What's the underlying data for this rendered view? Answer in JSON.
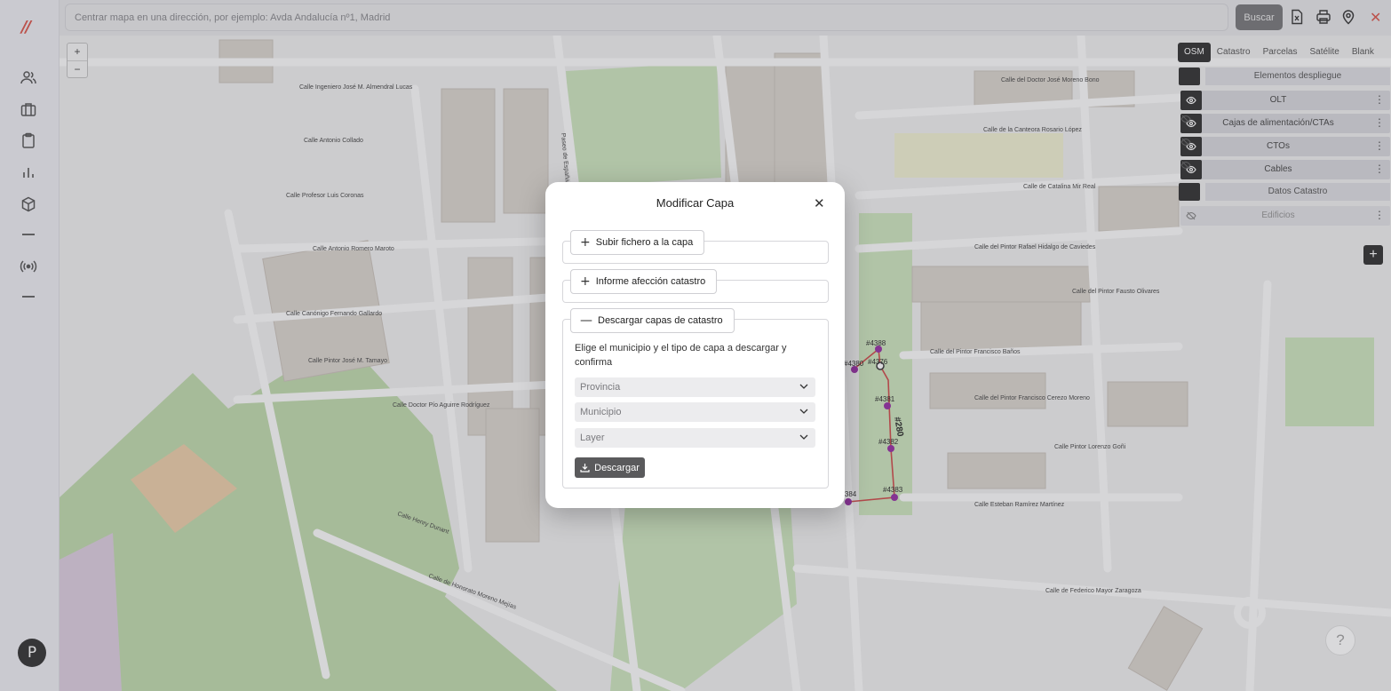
{
  "app": {
    "logo": "//"
  },
  "sidebar": {
    "items": [
      {
        "icon": "users-icon"
      },
      {
        "icon": "briefcase-icon"
      },
      {
        "icon": "clipboard-icon"
      },
      {
        "icon": "bar-chart-icon"
      },
      {
        "icon": "box-icon"
      },
      {
        "icon": "minus-icon"
      },
      {
        "icon": "broadcast-icon"
      },
      {
        "icon": "minus-icon"
      }
    ],
    "avatar_initial": "P"
  },
  "search": {
    "placeholder": "Centrar mapa en una dirección, por ejemplo: Avda Andalucía nº1, Madrid",
    "button_label": "Buscar"
  },
  "map": {
    "zoom_in": "+",
    "zoom_out": "−",
    "base_layers": [
      "OSM",
      "Catastro",
      "Parcelas",
      "Satélite",
      "Blank"
    ],
    "active_base_layer": "OSM",
    "groups": [
      {
        "title": "Elementos despliegue",
        "layers": [
          "OLT",
          "Cajas de alimentación/CTAs",
          "CTOs",
          "Cables"
        ]
      },
      {
        "title": "Datos Catastro",
        "layers": [
          "Edificios"
        ]
      }
    ],
    "add_label": "+",
    "help_label": "?",
    "street_labels": [
      "Calle Ingeniero José M. Almendral Lucas",
      "Calle Antonio Collado",
      "Calle Profesor Luis Coronas",
      "Calle Antonio Romero Maroto",
      "Calle Canónigo Fernando Gallardo",
      "Calle Pintor José M. Tamayo",
      "Calle Doctor Pío Aguirre Rodríguez",
      "Calle Henry Dunant",
      "Calle de Honorato Moreno Mejías",
      "Calle del Doctor José Moreno Bono",
      "Calle de la Canteora Rosario López",
      "Calle de Catalina Mir Real",
      "Calle del Pintor Rafael Hidalgo de Caviedes",
      "Calle del Pintor Fausto Olivares",
      "Calle del Pintor Francisco Baños",
      "Calle del Pintor Francisco Cerezo Moreno",
      "Calle Pintor Lorenzo Goñi",
      "Calle Esteban Ramírez Martínez",
      "Calle de Federico Mayor Zaragoza",
      "Paseo de España"
    ],
    "node_labels": [
      "#4388",
      "#4380",
      "#4376",
      "#4381",
      "#4382",
      "#4383",
      "#4384",
      "#280"
    ]
  },
  "modal": {
    "title": "Modificar Capa",
    "close": "✕",
    "sections": {
      "upload": {
        "symbol": "+",
        "label": "Subir fichero a la capa"
      },
      "report": {
        "symbol": "+",
        "label": "Informe afección catastro"
      },
      "download": {
        "symbol": "—",
        "label": "Descargar capas de catastro",
        "description": "Elige el municipio y el tipo de capa a descargar y confirma",
        "selects": [
          "Provincia",
          "Municipio",
          "Layer"
        ],
        "button_label": "Descargar"
      }
    }
  }
}
